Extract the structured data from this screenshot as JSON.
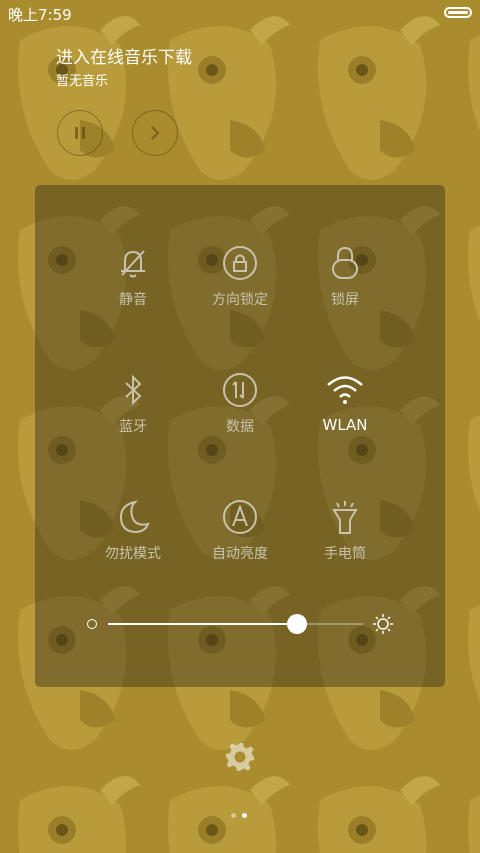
{
  "status_bar": {
    "time": "晚上7:59"
  },
  "music": {
    "title": "进入在线音乐下载",
    "subtitle": "暂无音乐"
  },
  "toggles": [
    {
      "label": "静音",
      "icon": "bell-off-icon",
      "active": false
    },
    {
      "label": "方向锁定",
      "icon": "rotation-lock-icon",
      "active": false
    },
    {
      "label": "锁屏",
      "icon": "lock-icon",
      "active": false
    },
    {
      "label": "蓝牙",
      "icon": "bluetooth-icon",
      "active": false
    },
    {
      "label": "数据",
      "icon": "mobile-data-icon",
      "active": false
    },
    {
      "label": "WLAN",
      "icon": "wifi-icon",
      "active": true
    },
    {
      "label": "勿扰模式",
      "icon": "moon-icon",
      "active": false
    },
    {
      "label": "自动亮度",
      "icon": "auto-brightness-icon",
      "active": false
    },
    {
      "label": "手电筒",
      "icon": "flashlight-icon",
      "active": false
    }
  ],
  "brightness": {
    "level": 0.74
  },
  "pager": {
    "pages": 2,
    "current": 2
  },
  "colors": {
    "wallpaper": "#a88c2e",
    "active": "#ffffff",
    "inactive": "#c9c3ad"
  }
}
